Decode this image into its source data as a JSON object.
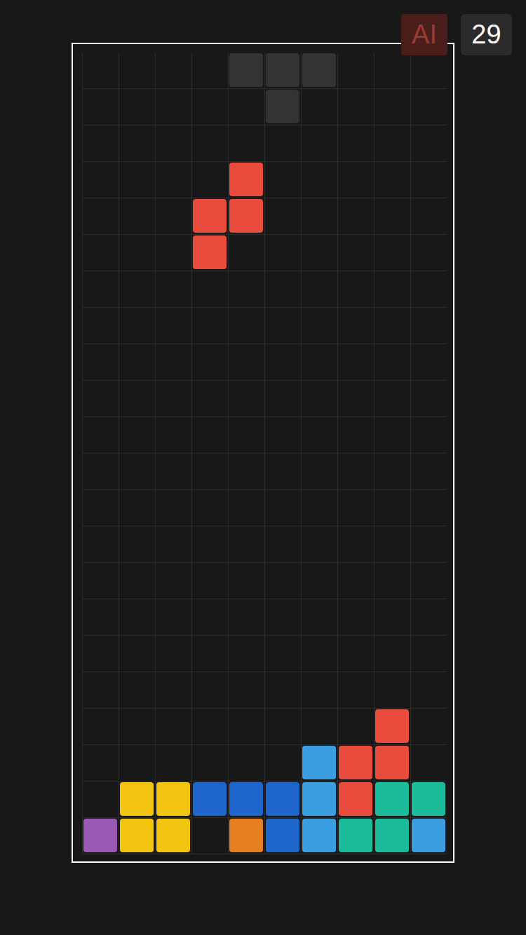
{
  "header": {
    "ai_label": "AI",
    "ai_enabled": false,
    "score": "29"
  },
  "board": {
    "rows": [
      [
        null,
        null,
        null,
        null,
        {
          "kind": "ghost",
          "color": "#333333"
        },
        {
          "kind": "ghost",
          "color": "#333333"
        },
        {
          "kind": "ghost",
          "color": "#333333"
        },
        null,
        null,
        null
      ],
      [
        null,
        null,
        null,
        null,
        null,
        {
          "kind": "ghost",
          "color": "#333333"
        },
        null,
        null,
        null,
        null
      ],
      [
        null,
        null,
        null,
        null,
        null,
        null,
        null,
        null,
        null,
        null
      ],
      [
        null,
        null,
        null,
        null,
        {
          "kind": "falling",
          "color": "#e74c3c"
        },
        null,
        null,
        null,
        null,
        null
      ],
      [
        null,
        null,
        null,
        {
          "kind": "falling",
          "color": "#e74c3c"
        },
        {
          "kind": "falling",
          "color": "#e74c3c"
        },
        null,
        null,
        null,
        null,
        null
      ],
      [
        null,
        null,
        null,
        {
          "kind": "falling",
          "color": "#e74c3c"
        },
        null,
        null,
        null,
        null,
        null,
        null
      ],
      [
        null,
        null,
        null,
        null,
        null,
        null,
        null,
        null,
        null,
        null
      ],
      [
        null,
        null,
        null,
        null,
        null,
        null,
        null,
        null,
        null,
        null
      ],
      [
        null,
        null,
        null,
        null,
        null,
        null,
        null,
        null,
        null,
        null
      ],
      [
        null,
        null,
        null,
        null,
        null,
        null,
        null,
        null,
        null,
        null
      ],
      [
        null,
        null,
        null,
        null,
        null,
        null,
        null,
        null,
        null,
        null
      ],
      [
        null,
        null,
        null,
        null,
        null,
        null,
        null,
        null,
        null,
        null
      ],
      [
        null,
        null,
        null,
        null,
        null,
        null,
        null,
        null,
        null,
        null
      ],
      [
        null,
        null,
        null,
        null,
        null,
        null,
        null,
        null,
        null,
        null
      ],
      [
        null,
        null,
        null,
        null,
        null,
        null,
        null,
        null,
        null,
        null
      ],
      [
        null,
        null,
        null,
        null,
        null,
        null,
        null,
        null,
        null,
        null
      ],
      [
        null,
        null,
        null,
        null,
        null,
        null,
        null,
        null,
        null,
        null
      ],
      [
        null,
        null,
        null,
        null,
        null,
        null,
        null,
        null,
        null,
        null
      ],
      [
        null,
        null,
        null,
        null,
        null,
        null,
        null,
        null,
        {
          "kind": "locked",
          "color": "#e74c3c"
        },
        null
      ],
      [
        null,
        null,
        null,
        null,
        null,
        null,
        {
          "kind": "locked",
          "color": "#3a9ee0"
        },
        {
          "kind": "locked",
          "color": "#e74c3c"
        },
        {
          "kind": "locked",
          "color": "#e74c3c"
        },
        null
      ],
      [
        null,
        {
          "kind": "locked",
          "color": "#f1c40f"
        },
        {
          "kind": "locked",
          "color": "#f1c40f"
        },
        {
          "kind": "locked",
          "color": "#1e66c9"
        },
        {
          "kind": "locked",
          "color": "#1e66c9"
        },
        {
          "kind": "locked",
          "color": "#1e66c9"
        },
        {
          "kind": "locked",
          "color": "#3a9ee0"
        },
        {
          "kind": "locked",
          "color": "#e74c3c"
        },
        {
          "kind": "locked",
          "color": "#1abc9c"
        },
        {
          "kind": "locked",
          "color": "#1abc9c"
        }
      ],
      [
        {
          "kind": "locked",
          "color": "#9b59b6"
        },
        {
          "kind": "locked",
          "color": "#f1c40f"
        },
        {
          "kind": "locked",
          "color": "#f1c40f"
        },
        null,
        {
          "kind": "locked",
          "color": "#e67e22"
        },
        {
          "kind": "locked",
          "color": "#1e66c9"
        },
        {
          "kind": "locked",
          "color": "#3a9ee0"
        },
        {
          "kind": "locked",
          "color": "#1abc9c"
        },
        {
          "kind": "locked",
          "color": "#1abc9c"
        },
        {
          "kind": "locked",
          "color": "#3a9ee0"
        }
      ]
    ]
  }
}
